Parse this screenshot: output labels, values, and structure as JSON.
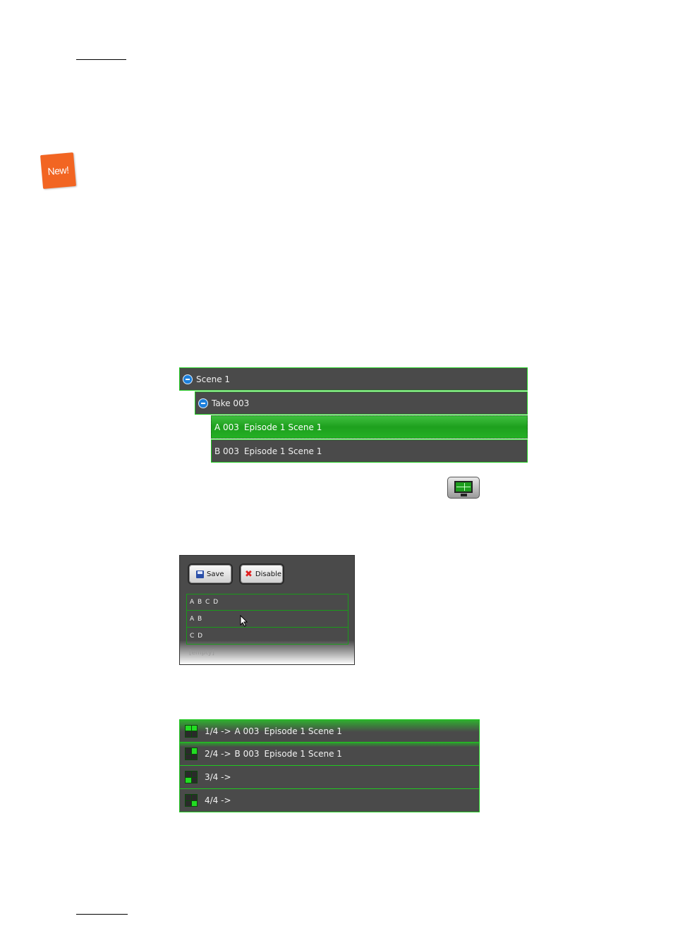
{
  "badge": {
    "text": "New!"
  },
  "tree": {
    "rows": [
      {
        "label": "Scene 1"
      },
      {
        "label": "Take 003"
      },
      {
        "code": "A 003",
        "name": "Episode 1 Scene 1"
      },
      {
        "code": "B 003",
        "name": "Episode 1 Scene 1"
      }
    ]
  },
  "icons": {
    "monitor": "monitor-split-icon"
  },
  "preset_panel": {
    "save_label": "Save",
    "disable_label": "Disable",
    "items": [
      "A B C D",
      "A B",
      "C D",
      "[empty]"
    ]
  },
  "channels": {
    "rows": [
      {
        "index": "1/4 ->",
        "code": "A 003",
        "name": "Episode 1 Scene 1"
      },
      {
        "index": "2/4 ->",
        "code": "B 003",
        "name": "Episode 1 Scene 1"
      },
      {
        "index": "3/4 ->",
        "code": "",
        "name": ""
      },
      {
        "index": "4/4 ->",
        "code": "",
        "name": ""
      }
    ]
  }
}
